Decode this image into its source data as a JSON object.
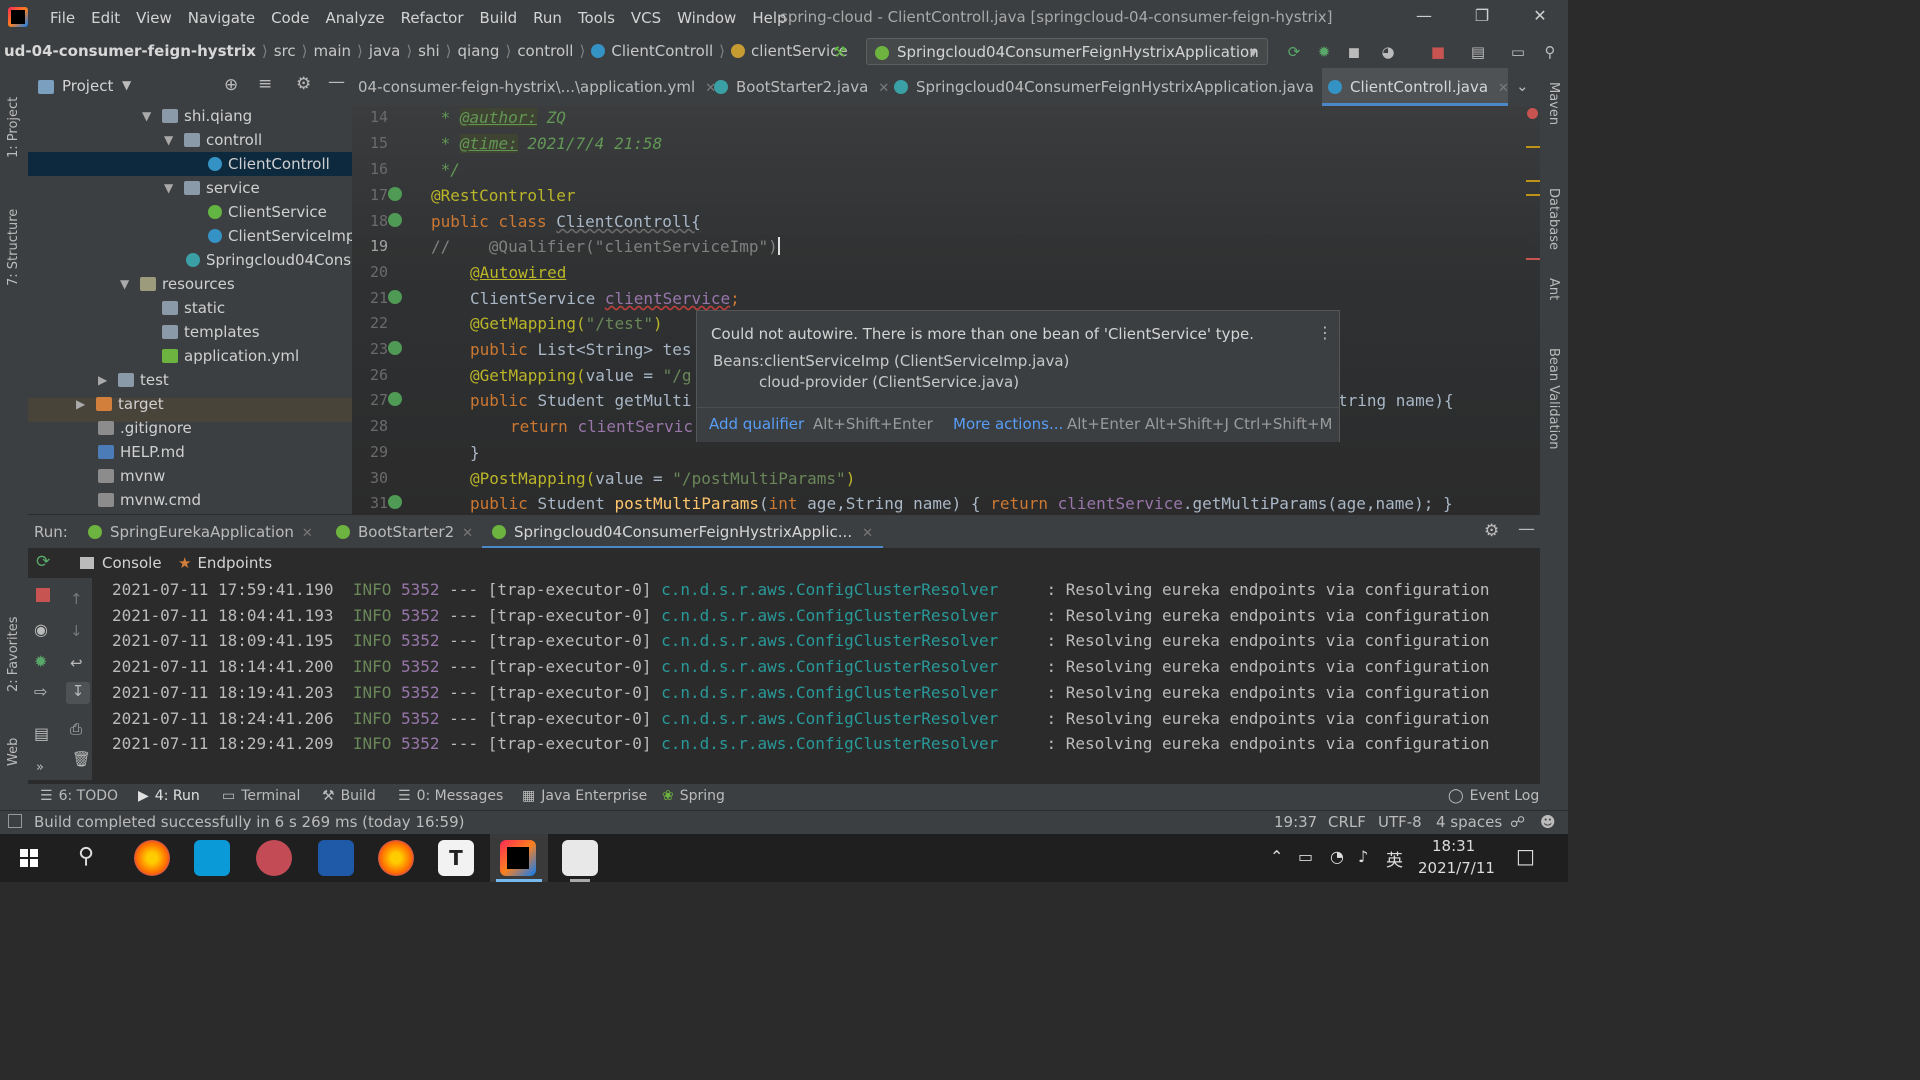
{
  "window": {
    "title": "spring-cloud - ClientControll.java [springcloud-04-consumer-feign-hystrix]",
    "menu": [
      "File",
      "Edit",
      "View",
      "Navigate",
      "Code",
      "Analyze",
      "Refactor",
      "Build",
      "Run",
      "Tools",
      "VCS",
      "Window",
      "Help"
    ]
  },
  "breadcrumb": [
    "ud-04-consumer-feign-hystrix",
    "src",
    "main",
    "java",
    "shi",
    "qiang",
    "controll",
    "ClientControll",
    "clientService"
  ],
  "run_config": "Springcloud04ConsumerFeignHystrixApplication",
  "left_stripe": {
    "project": "1: Project",
    "structure": "7: Structure",
    "favorites": "2: Favorites",
    "web": "Web"
  },
  "right_stripe": {
    "maven": "Maven",
    "database": "Database",
    "ant": "Ant",
    "validation": "Bean Validation"
  },
  "project_panel": {
    "title": "Project",
    "tree": [
      {
        "label": "shi.qiang",
        "type": "folder",
        "expanded": true
      },
      {
        "label": "controll",
        "type": "folder",
        "expanded": true
      },
      {
        "label": "ClientControll",
        "type": "class",
        "selected": true
      },
      {
        "label": "service",
        "type": "folder",
        "expanded": true
      },
      {
        "label": "ClientService",
        "type": "interface"
      },
      {
        "label": "ClientServiceImp",
        "type": "class"
      },
      {
        "label": "Springcloud04Consu",
        "type": "springclass"
      },
      {
        "label": "resources",
        "type": "folder",
        "expanded": true
      },
      {
        "label": "static",
        "type": "folder"
      },
      {
        "label": "templates",
        "type": "folder"
      },
      {
        "label": "application.yml",
        "type": "yml"
      },
      {
        "label": "test",
        "type": "folder",
        "expanded": false
      },
      {
        "label": "target",
        "type": "folder",
        "expanded": false
      },
      {
        "label": ".gitignore",
        "type": "file"
      },
      {
        "label": "HELP.md",
        "type": "file"
      },
      {
        "label": "mvnw",
        "type": "file"
      },
      {
        "label": "mvnw.cmd",
        "type": "file"
      }
    ]
  },
  "editor_tabs": [
    {
      "label": "04-consumer-feign-hystrix\\...\\application.yml"
    },
    {
      "label": "BootStarter2.java"
    },
    {
      "label": "Springcloud04ConsumerFeignHystrixApplication.java"
    },
    {
      "label": "ClientControll.java",
      "active": true
    }
  ],
  "code": {
    "line_numbers": [
      "14",
      "15",
      "16",
      "17",
      "18",
      "19",
      "20",
      "21",
      "22",
      "23",
      "26",
      "27",
      "28",
      "29",
      "30",
      "31"
    ],
    "l14_tag": "@author:",
    "l14_val": " ZQ",
    "l15_tag": "@time:",
    "l15_val": " 2021/7/4 21:58",
    "l16": " */",
    "l17": "@RestController",
    "l18_kw": "public class ",
    "l18_rest": "ClientControll{",
    "l19_cmt": "//    ",
    "l19_an": "@Qualifier(",
    "l19_str": "\"clientServiceImp\"",
    "l19_close": ")",
    "l20": "@Autowired",
    "l21_type": "ClientService ",
    "l21_field": "clientService",
    "l21_semi": ";",
    "l22_an": "@GetMapping(",
    "l22_str": "\"/test\"",
    "l22_close": ")",
    "l23_kw": "public ",
    "l23_rest": "List<String> tes",
    "l26_an": "@GetMapping(",
    "l26_key": "value = ",
    "l26_str": "\"/g",
    "l27_kw": "public ",
    "l27_rest": "Student getMulti",
    "l27_tail": "tring name){",
    "l28_kw": "return ",
    "l28_rest": "clientServic",
    "l29": "}",
    "l30_an": "@PostMapping(",
    "l30_key": "value = ",
    "l30_str": "\"/postMultiParams\"",
    "l30_close": ")",
    "l31_kw": "public ",
    "l31_a": "Student ",
    "l31_m": "postMultiParams",
    "l31_b": "(",
    "l31_kw2": "int ",
    "l31_c": "age,String name) { ",
    "l31_kw3": "return ",
    "l31_f": "clientService",
    "l31_d": ".getMultiParams(age,name); }"
  },
  "popup": {
    "message": "Could not autowire. There is more than one bean of 'ClientService' type.",
    "beans_label": "Beans:",
    "bean1": "clientServiceImp   (ClientServiceImp.java)",
    "bean2": "cloud-provider   (ClientService.java)",
    "action1": "Add qualifier",
    "action1_keys": "Alt+Shift+Enter",
    "action2": "More actions...",
    "action2_keys": "Alt+Enter Alt+Shift+J Ctrl+Shift+M"
  },
  "run_panel": {
    "label": "Run:",
    "tabs": [
      "SpringEurekaApplication",
      "BootStarter2",
      "Springcloud04ConsumerFeignHystrixApplic..."
    ],
    "console_tab": "Console",
    "endpoints_tab": "Endpoints"
  },
  "log": [
    {
      "ts": "2021-07-11 17:59:41.190",
      "level": "INFO",
      "pid": "5352",
      "sep": "---",
      "thread": "[trap-executor-0]",
      "cls": "c.n.d.s.r.aws.ConfigClusterResolver",
      "msg": ": Resolving eureka endpoints via configuration"
    },
    {
      "ts": "2021-07-11 18:04:41.193",
      "level": "INFO",
      "pid": "5352",
      "sep": "---",
      "thread": "[trap-executor-0]",
      "cls": "c.n.d.s.r.aws.ConfigClusterResolver",
      "msg": ": Resolving eureka endpoints via configuration"
    },
    {
      "ts": "2021-07-11 18:09:41.195",
      "level": "INFO",
      "pid": "5352",
      "sep": "---",
      "thread": "[trap-executor-0]",
      "cls": "c.n.d.s.r.aws.ConfigClusterResolver",
      "msg": ": Resolving eureka endpoints via configuration"
    },
    {
      "ts": "2021-07-11 18:14:41.200",
      "level": "INFO",
      "pid": "5352",
      "sep": "---",
      "thread": "[trap-executor-0]",
      "cls": "c.n.d.s.r.aws.ConfigClusterResolver",
      "msg": ": Resolving eureka endpoints via configuration"
    },
    {
      "ts": "2021-07-11 18:19:41.203",
      "level": "INFO",
      "pid": "5352",
      "sep": "---",
      "thread": "[trap-executor-0]",
      "cls": "c.n.d.s.r.aws.ConfigClusterResolver",
      "msg": ": Resolving eureka endpoints via configuration"
    },
    {
      "ts": "2021-07-11 18:24:41.206",
      "level": "INFO",
      "pid": "5352",
      "sep": "---",
      "thread": "[trap-executor-0]",
      "cls": "c.n.d.s.r.aws.ConfigClusterResolver",
      "msg": ": Resolving eureka endpoints via configuration"
    },
    {
      "ts": "2021-07-11 18:29:41.209",
      "level": "INFO",
      "pid": "5352",
      "sep": "---",
      "thread": "[trap-executor-0]",
      "cls": "c.n.d.s.r.aws.ConfigClusterResolver",
      "msg": ": Resolving eureka endpoints via configuration"
    }
  ],
  "tool_tabs": [
    "6: TODO",
    "4: Run",
    "Terminal",
    "Build",
    "0: Messages",
    "Java Enterprise",
    "Spring",
    "Event Log"
  ],
  "status": {
    "message": "Build completed successfully in 6 s 269 ms (today 16:59)",
    "position": "19:37",
    "line_sep": "CRLF",
    "encoding": "UTF-8",
    "indent": "4 spaces"
  },
  "taskbar": {
    "time": "18:31",
    "date": "2021/7/11",
    "ime": "英"
  },
  "colors": {
    "accent": "#4a88c7",
    "link": "#589df6",
    "keyword": "#cc7832",
    "annotation": "#bbb529",
    "string": "#6a8759"
  }
}
